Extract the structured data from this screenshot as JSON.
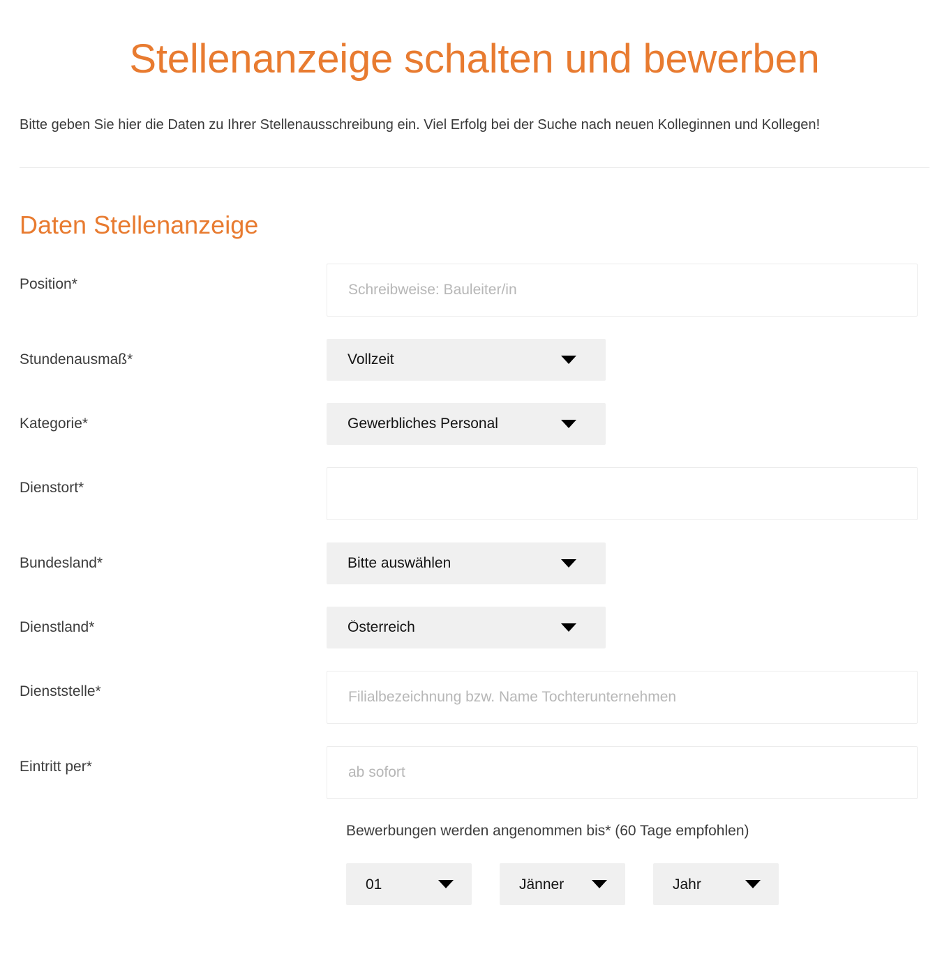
{
  "header": {
    "title": "Stellenanzeige schalten und bewerben",
    "intro": "Bitte geben Sie hier die Daten zu Ihrer Stellenausschreibung ein. Viel Erfolg bei der Suche nach neuen Kolleginnen und Kollegen!"
  },
  "section": {
    "title": "Daten Stellenanzeige"
  },
  "fields": {
    "position": {
      "label": "Position*",
      "placeholder": "Schreibweise: Bauleiter/in",
      "value": ""
    },
    "stundenausmass": {
      "label": "Stundenausmaß*",
      "value": "Vollzeit"
    },
    "kategorie": {
      "label": "Kategorie*",
      "value": "Gewerbliches Personal"
    },
    "dienstort": {
      "label": "Dienstort*",
      "placeholder": "",
      "value": ""
    },
    "bundesland": {
      "label": "Bundesland*",
      "value": "Bitte auswählen"
    },
    "dienstland": {
      "label": "Dienstland*",
      "value": "Österreich"
    },
    "dienststelle": {
      "label": "Dienststelle*",
      "placeholder": "Filialbezeichnung bzw. Name Tochterunternehmen",
      "value": ""
    },
    "eintritt_per": {
      "label": "Eintritt per*",
      "placeholder": "ab sofort",
      "value": ""
    }
  },
  "deadline": {
    "label": "Bewerbungen werden angenommen bis* (60 Tage empfohlen)",
    "day": "01",
    "month": "Jänner",
    "year": "Jahr"
  },
  "icons": {
    "dropdown": "chevron-down-icon"
  },
  "colors": {
    "accent": "#E87B30",
    "text": "#3c3c3c",
    "placeholder": "#b7b7b7",
    "select_background": "#f0f0f0",
    "input_border": "#ececec",
    "divider": "#e9e9e9"
  }
}
